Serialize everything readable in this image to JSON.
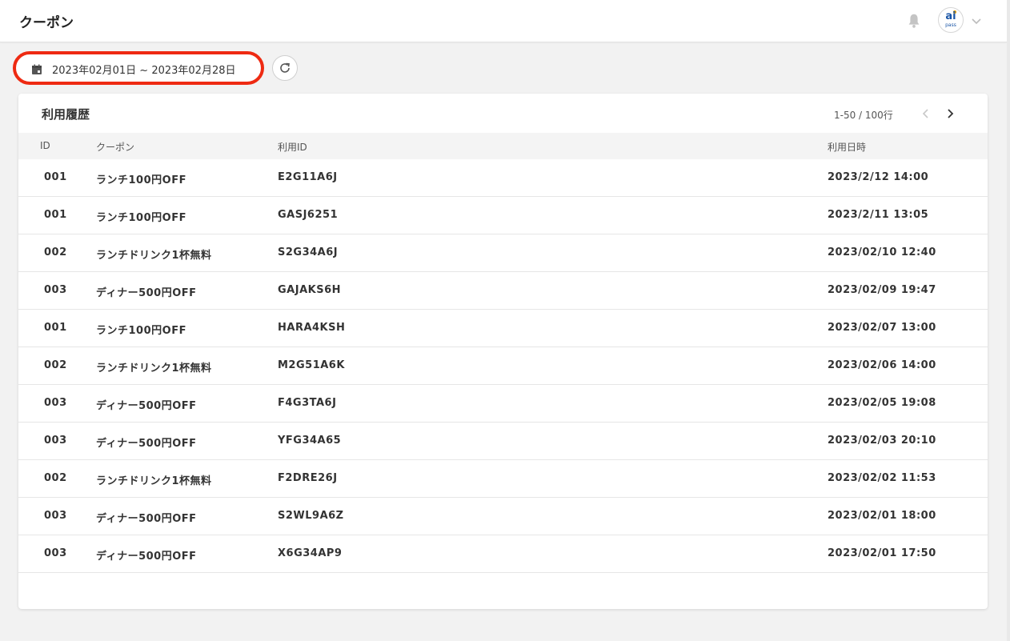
{
  "header": {
    "title": "クーポン",
    "avatar_text": "ai",
    "avatar_subtext": "pass"
  },
  "filter": {
    "date_range": "2023年02月01日 ~ 2023年02月28日"
  },
  "card": {
    "title": "利用履歴",
    "pager": "1-50 / 100行"
  },
  "table": {
    "columns": {
      "id": "ID",
      "coupon": "クーポン",
      "use_id": "利用ID",
      "used_at": "利用日時"
    },
    "rows": [
      {
        "id": "001",
        "coupon": "ランチ100円OFF",
        "use_id": "E2G11A6J",
        "used_at": "2023/2/12 14:00"
      },
      {
        "id": "001",
        "coupon": "ランチ100円OFF",
        "use_id": "GASJ6251",
        "used_at": "2023/2/11 13:05"
      },
      {
        "id": "002",
        "coupon": "ランチドリンク1杯無料",
        "use_id": "S2G34A6J",
        "used_at": "2023/02/10 12:40"
      },
      {
        "id": "003",
        "coupon": "ディナー500円OFF",
        "use_id": "GAJAKS6H",
        "used_at": "2023/02/09 19:47"
      },
      {
        "id": "001",
        "coupon": "ランチ100円OFF",
        "use_id": "HARA4KSH",
        "used_at": "2023/02/07 13:00"
      },
      {
        "id": "002",
        "coupon": "ランチドリンク1杯無料",
        "use_id": "M2G51A6K",
        "used_at": "2023/02/06 14:00"
      },
      {
        "id": "003",
        "coupon": "ディナー500円OFF",
        "use_id": "F4G3TA6J",
        "used_at": "2023/02/05 19:08"
      },
      {
        "id": "003",
        "coupon": "ディナー500円OFF",
        "use_id": "YFG34A65",
        "used_at": "2023/02/03 20:10"
      },
      {
        "id": "002",
        "coupon": "ランチドリンク1杯無料",
        "use_id": "F2DRE26J",
        "used_at": "2023/02/02 11:53"
      },
      {
        "id": "003",
        "coupon": "ディナー500円OFF",
        "use_id": "S2WL9A6Z",
        "used_at": "2023/02/01 18:00"
      },
      {
        "id": "003",
        "coupon": "ディナー500円OFF",
        "use_id": "X6G34AP9",
        "used_at": "2023/02/01 17:50"
      }
    ]
  },
  "icons": {
    "notification": "bell-icon",
    "user_menu": "chevron-down-icon",
    "date": "calendar-icon",
    "refresh": "refresh-icon",
    "prev": "chevron-left-icon",
    "next": "chevron-right-icon"
  },
  "colors": {
    "highlight_outline": "#ee2a12",
    "avatar_brand": "#1a55a6",
    "avatar_dot": "#f0a500"
  }
}
